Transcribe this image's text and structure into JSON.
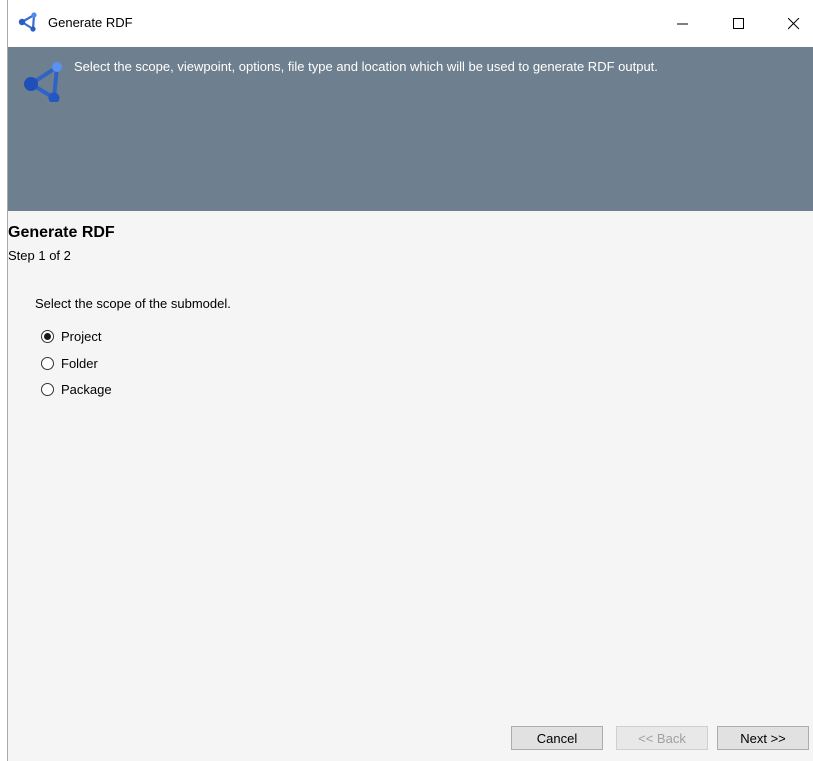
{
  "window": {
    "title": "Generate RDF",
    "controls": {
      "minimize": "—",
      "maximize": "☐",
      "close": "✕"
    }
  },
  "banner": {
    "description": "Select the scope, viewpoint, options, file type and location which will be used to generate RDF output.",
    "color": "#6e7f8f"
  },
  "page": {
    "heading": "Generate RDF",
    "step": "Step 1 of 2",
    "prompt": "Select the scope of the submodel."
  },
  "scope_options": [
    {
      "label": "Project",
      "selected": true
    },
    {
      "label": "Folder",
      "selected": false
    },
    {
      "label": "Package",
      "selected": false
    }
  ],
  "buttons": {
    "cancel": "Cancel",
    "back": "<< Back",
    "next": "Next >>"
  },
  "icons": {
    "app": "rdf-graph-icon",
    "banner": "rdf-graph-icon"
  }
}
